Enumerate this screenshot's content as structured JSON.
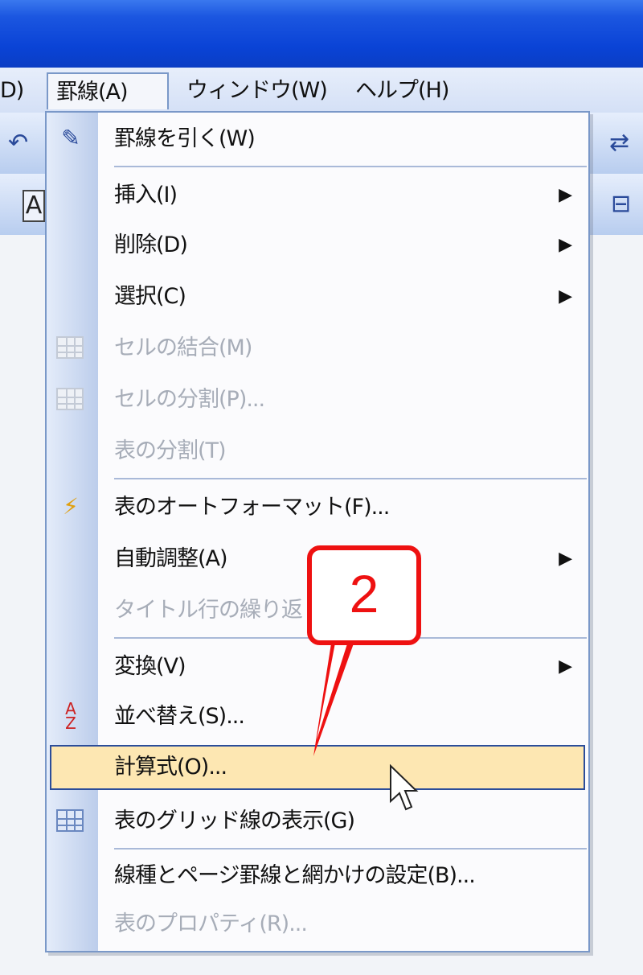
{
  "menubar": {
    "items": [
      {
        "label": "D)"
      },
      {
        "label": "罫線(A)"
      },
      {
        "label": "ウィンドウ(W)"
      },
      {
        "label": "ヘルプ(H)"
      }
    ]
  },
  "menu": {
    "items": [
      {
        "label": "罫線を引く(W)",
        "icon": "draw-table-icon"
      },
      {
        "label": "挿入(I)",
        "submenu": true
      },
      {
        "label": "削除(D)",
        "submenu": true
      },
      {
        "label": "選択(C)",
        "submenu": true
      },
      {
        "label": "セルの結合(M)",
        "disabled": true,
        "icon": "merge-cells-icon"
      },
      {
        "label": "セルの分割(P)...",
        "disabled": true,
        "icon": "split-cells-icon"
      },
      {
        "label": "表の分割(T)",
        "disabled": true
      },
      {
        "label": "表のオートフォーマット(F)...",
        "icon": "autoformat-icon"
      },
      {
        "label": "自動調整(A)",
        "submenu": true
      },
      {
        "label": "タイトル行の繰り返し",
        "disabled": true
      },
      {
        "label": "変換(V)",
        "submenu": true
      },
      {
        "label": "並べ替え(S)...",
        "icon": "sort-az-icon"
      },
      {
        "label": "計算式(O)...",
        "highlighted": true
      },
      {
        "label": "表のグリッド線の表示(G)",
        "icon": "grid-icon"
      },
      {
        "label": "線種とページ罫線と網かけの設定(B)..."
      },
      {
        "label": "表のプロパティ(R)...",
        "disabled": true
      }
    ],
    "submenu_arrow": "▶"
  },
  "callout": {
    "number": "2",
    "color": "#ee1111"
  },
  "colors": {
    "titlebar": "#0a43d6",
    "highlight_bg": "#fde7b2",
    "highlight_border": "#2b4d9a",
    "disabled_text": "#a7adb8"
  }
}
